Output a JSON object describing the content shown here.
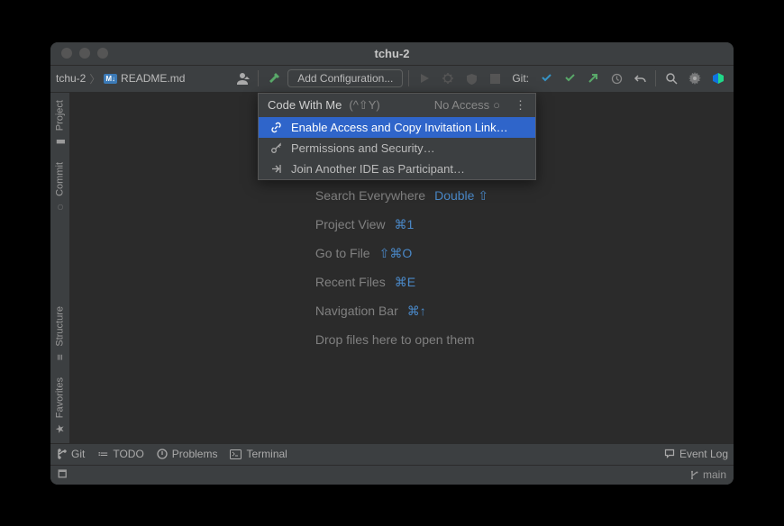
{
  "window": {
    "title": "tchu-2"
  },
  "breadcrumb": {
    "project": "tchu-2",
    "file": "README.md"
  },
  "toolbar": {
    "add_configuration": "Add Configuration...",
    "git_label": "Git:"
  },
  "popup": {
    "title": "Code With Me",
    "shortcut": "(^⇧Y)",
    "status": "No Access",
    "items": [
      {
        "icon": "link",
        "label": "Enable Access and Copy Invitation Link…",
        "selected": true
      },
      {
        "icon": "key",
        "label": "Permissions and Security…",
        "selected": false
      },
      {
        "icon": "join",
        "label": "Join Another IDE as Participant…",
        "selected": false
      }
    ]
  },
  "empty_hints": [
    {
      "label": "Search Everywhere",
      "shortcut": "Double ⇧"
    },
    {
      "label": "Project View",
      "shortcut": "⌘1"
    },
    {
      "label": "Go to File",
      "shortcut": "⇧⌘O"
    },
    {
      "label": "Recent Files",
      "shortcut": "⌘E"
    },
    {
      "label": "Navigation Bar",
      "shortcut": "⌘↑"
    },
    {
      "label": "Drop files here to open them",
      "shortcut": ""
    }
  ],
  "left_tabs": {
    "project": "Project",
    "commit": "Commit",
    "structure": "Structure",
    "favorites": "Favorites"
  },
  "bottom_bar": {
    "git": "Git",
    "todo": "TODO",
    "problems": "Problems",
    "terminal": "Terminal",
    "event_log": "Event Log"
  },
  "status_bar": {
    "branch": "main"
  }
}
